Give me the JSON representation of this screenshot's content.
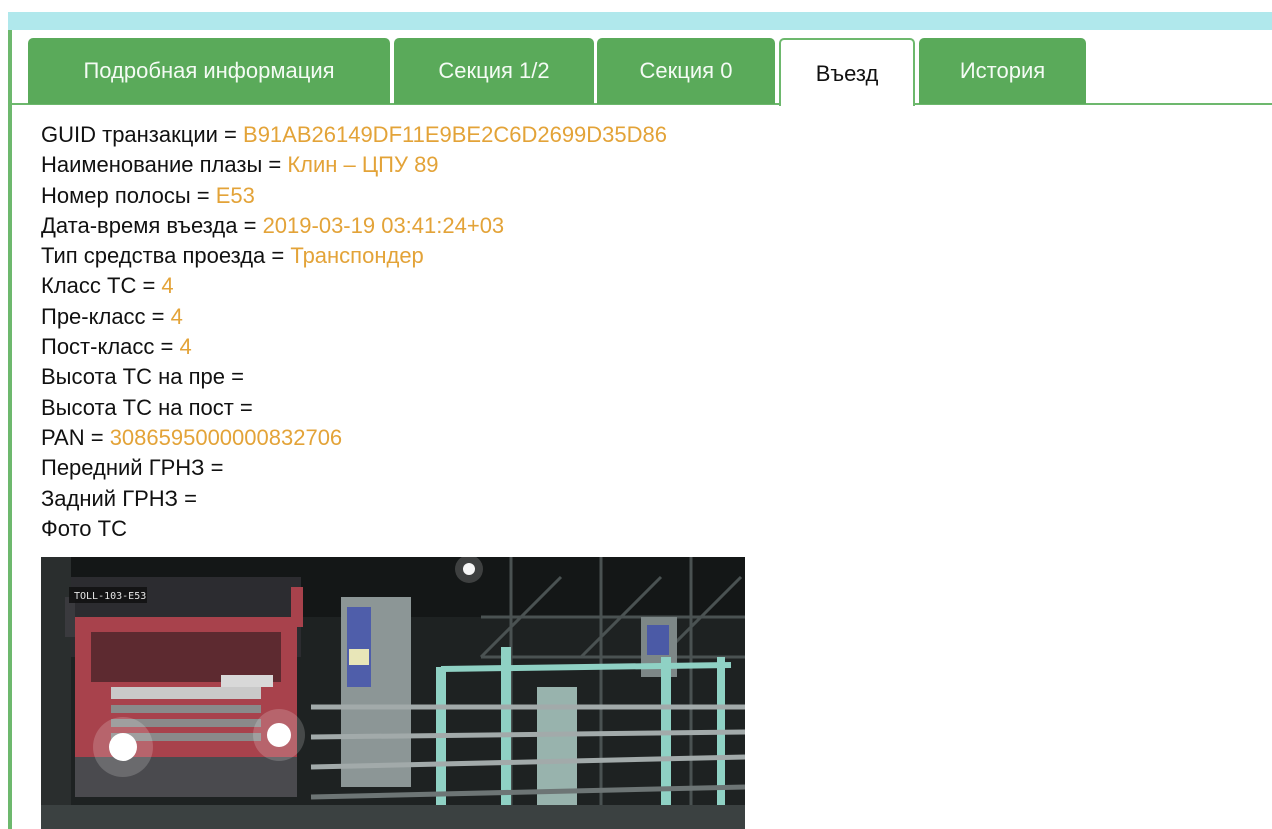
{
  "tabs": [
    {
      "label": "Подробная информация",
      "active": false
    },
    {
      "label": "Секция 1/2",
      "active": false
    },
    {
      "label": "Секция 0",
      "active": false
    },
    {
      "label": "Въезд",
      "active": true
    },
    {
      "label": "История",
      "active": false
    }
  ],
  "fields": [
    {
      "label": "GUID транзакции = ",
      "value": "B91AB26149DF11E9BE2C6D2699D35D86"
    },
    {
      "label": "Наименование плазы = ",
      "value": "Клин – ЦПУ 89"
    },
    {
      "label": "Номер полосы = ",
      "value": "E53"
    },
    {
      "label": "Дата-время въезда = ",
      "value": "2019-03-19 03:41:24+03"
    },
    {
      "label": "Тип средства проезда = ",
      "value": "Транспондер"
    },
    {
      "label": "Класс ТС = ",
      "value": "4"
    },
    {
      "label": "Пре-класс = ",
      "value": "4"
    },
    {
      "label": "Пост-класс = ",
      "value": "4"
    },
    {
      "label": "Высота ТС на пре = ",
      "value": ""
    },
    {
      "label": "Высота ТС на пост = ",
      "value": ""
    },
    {
      "label": "PAN = ",
      "value": "3086595000000832706"
    },
    {
      "label": "Передний ГРНЗ = ",
      "value": ""
    },
    {
      "label": "Задний ГРНЗ = ",
      "value": ""
    },
    {
      "label": "Фото ТС",
      "value": ""
    }
  ],
  "photo": {
    "overlay_text": "TOLL-103-E53"
  },
  "colors": {
    "tab_green": "#5aaa5a",
    "value_orange": "#e3a338",
    "top_bar": "#b0e8ec"
  }
}
